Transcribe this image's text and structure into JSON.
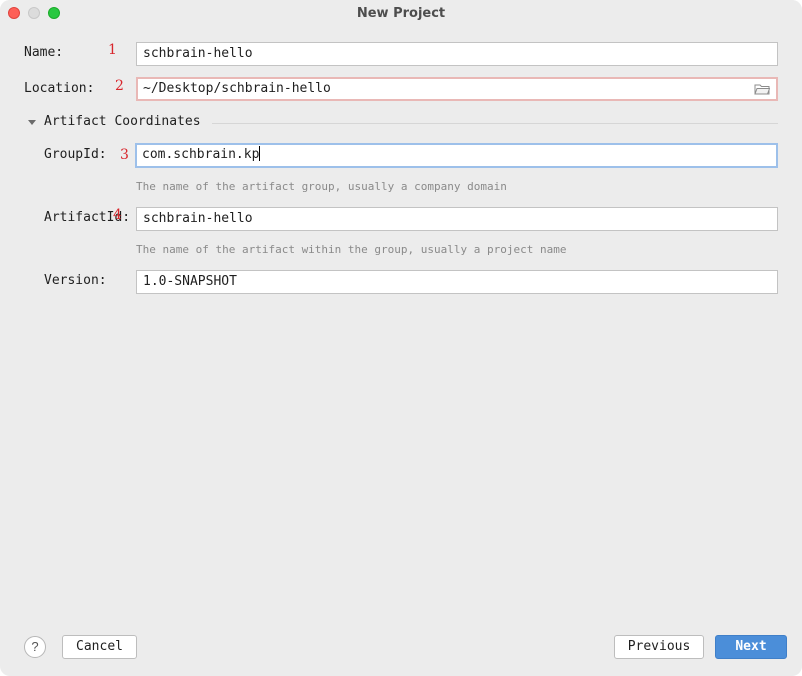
{
  "window": {
    "title": "New Project"
  },
  "form": {
    "name": {
      "label": "Name:",
      "marker": "1",
      "value": "schbrain-hello"
    },
    "location": {
      "label": "Location:",
      "marker": "2",
      "value": "~/Desktop/schbrain-hello"
    },
    "section": {
      "title": "Artifact Coordinates",
      "expanded": true
    },
    "group_id": {
      "label": "GroupId:",
      "marker": "3",
      "value": "com.schbrain.kp",
      "hint": "The name of the artifact group, usually a company domain"
    },
    "artifact_id": {
      "label": "ArtifactId:",
      "marker": "4",
      "value": "schbrain-hello",
      "hint": "The name of the artifact within the group, usually a project name"
    },
    "version": {
      "label": "Version:",
      "value": "1.0-SNAPSHOT"
    }
  },
  "footer": {
    "help_label": "?",
    "cancel_label": "Cancel",
    "previous_label": "Previous",
    "next_label": "Next"
  },
  "icons": {
    "location_browse": "folder-icon",
    "section_toggle": "triangle-down-icon"
  },
  "colors": {
    "accent": "#4b8ed9",
    "marker": "#d8262c",
    "error_border": "#e9b8b6",
    "focus_border": "#9dc0ea"
  }
}
